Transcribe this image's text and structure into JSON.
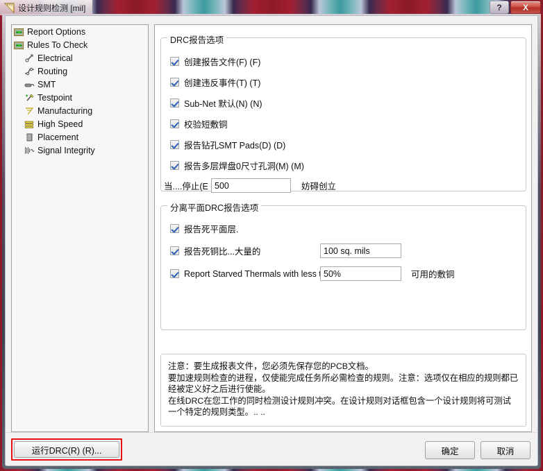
{
  "window": {
    "title": "设计规则检测 [mil]",
    "icon": "ruler-triangle-icon",
    "help_label": "?",
    "close_label": "X"
  },
  "sidebar": {
    "items": [
      {
        "label": "Report Options",
        "icon": "folder-options-icon",
        "level": 0
      },
      {
        "label": "Rules To Check",
        "icon": "folder-options-icon",
        "level": 0
      },
      {
        "label": "Electrical",
        "icon": "electrical-icon",
        "level": 1
      },
      {
        "label": "Routing",
        "icon": "routing-icon",
        "level": 1
      },
      {
        "label": "SMT",
        "icon": "smt-icon",
        "level": 1
      },
      {
        "label": "Testpoint",
        "icon": "testpoint-icon",
        "level": 1
      },
      {
        "label": "Manufacturing",
        "icon": "manufacturing-icon",
        "level": 1
      },
      {
        "label": "High Speed",
        "icon": "high-speed-icon",
        "level": 1
      },
      {
        "label": "Placement",
        "icon": "placement-icon",
        "level": 1
      },
      {
        "label": "Signal Integrity",
        "icon": "signal-integrity-icon",
        "level": 1
      }
    ]
  },
  "drc_report_options": {
    "title": "DRC报告选项",
    "checkbox_create_report_file": "创建报告文件(F) (F)",
    "checkbox_create_violations": "创建违反事件(T) (T)",
    "checkbox_subnet_default": "Sub-Net 默认(N) (N)",
    "checkbox_verify_shorts": "校验短敷铜",
    "checkbox_report_drilled_smt": "报告钻孔SMT Pads(D) (D)",
    "checkbox_report_multilayer": "报告多层焊盘0尺寸孔洞(M) (M)",
    "stop_when_label": "当....停止(E",
    "stop_when_value": "500",
    "stop_when_suffix": "妨碍创立"
  },
  "split_plane_options": {
    "title": "分离平面DRC报告选项",
    "checkbox_dead_plane": "报告死平面层.",
    "checkbox_dead_copper": "报告死铜比...大量的",
    "dead_copper_value": "100 sq. mils",
    "checkbox_starved_thermals": "Report Starved Thermals with less than",
    "starved_thermals_value": "50%",
    "starved_thermals_suffix": "可用的敷铜"
  },
  "notes": {
    "line1": "注意：要生成报表文件，您必须先保存您的PCB文档。",
    "line2": "要加速规则检查的进程，仅使能完成任务所必需检查的规则。注意：选项仅在相应的规则都已经被定义好之后进行使能。",
    "line3": "在线DRC在您工作的同时检测设计规则冲突。在设计规则对话框包含一个设计规则将可测试一个特定的规则类型。.. .."
  },
  "footer": {
    "run_drc_label": "运行DRC(R) (R)...",
    "ok_label": "确定",
    "cancel_label": "取消"
  },
  "colors": {
    "accent_red": "#e81010",
    "check_blue": "#2d62b8",
    "panel_bg": "#f1f1f1"
  }
}
